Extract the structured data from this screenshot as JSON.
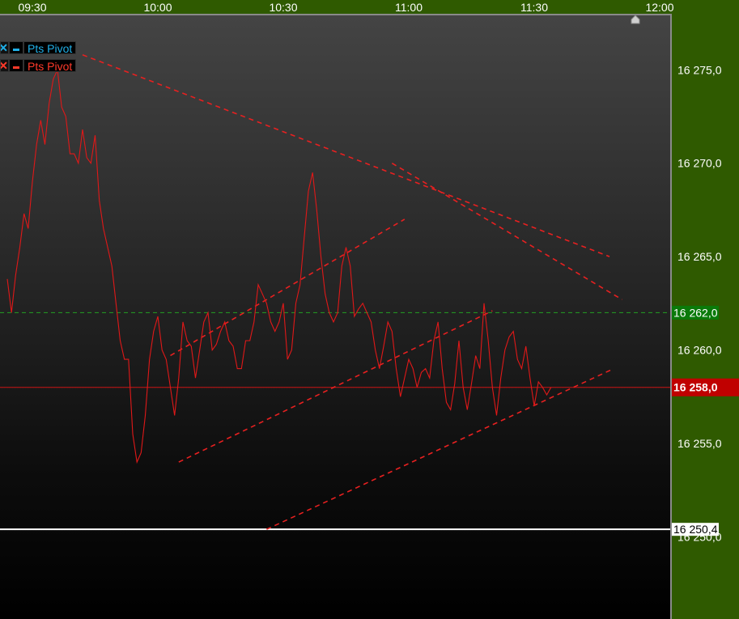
{
  "legend": [
    {
      "label": "Pts Pivot",
      "color": "#20b0e8",
      "close_glyph": "✕"
    },
    {
      "label": "Pts Pivot",
      "color": "#ff3a2a",
      "close_glyph": "✕"
    }
  ],
  "chart_data": {
    "type": "line",
    "x_axis": {
      "ticks": [
        "09:30",
        "10:00",
        "10:30",
        "11:00",
        "11:30",
        "12:00"
      ],
      "unit": "time"
    },
    "y_axis": {
      "tick_labels": [
        "16 275,0",
        "16 270,0",
        "16 265,0",
        "16 260,0",
        "16 255,0",
        "16 250,0"
      ],
      "tick_values": [
        16275.0,
        16270.0,
        16265.0,
        16260.0,
        16255.0,
        16250.0
      ],
      "ylim": [
        16245.6,
        16278.0
      ]
    },
    "series": [
      {
        "color": "#e01818",
        "times": [
          "09:24",
          "09:25",
          "09:26",
          "09:27",
          "09:28",
          "09:29",
          "09:30",
          "09:31",
          "09:32",
          "09:33",
          "09:34",
          "09:35",
          "09:36",
          "09:37",
          "09:38",
          "09:39",
          "09:40",
          "09:41",
          "09:42",
          "09:43",
          "09:44",
          "09:45",
          "09:46",
          "09:47",
          "09:48",
          "09:49",
          "09:50",
          "09:51",
          "09:52",
          "09:53",
          "09:54",
          "09:55",
          "09:56",
          "09:57",
          "09:58",
          "09:59",
          "10:00",
          "10:01",
          "10:02",
          "10:03",
          "10:04",
          "10:05",
          "10:06",
          "10:07",
          "10:08",
          "10:09",
          "10:10",
          "10:11",
          "10:12",
          "10:13",
          "10:14",
          "10:15",
          "10:16",
          "10:17",
          "10:18",
          "10:19",
          "10:20",
          "10:21",
          "10:22",
          "10:23",
          "10:24",
          "10:25",
          "10:26",
          "10:27",
          "10:28",
          "10:29",
          "10:30",
          "10:31",
          "10:32",
          "10:33",
          "10:34",
          "10:35",
          "10:36",
          "10:37",
          "10:38",
          "10:39",
          "10:40",
          "10:41",
          "10:42",
          "10:43",
          "10:44",
          "10:45",
          "10:46",
          "10:47",
          "10:48",
          "10:49",
          "10:50",
          "10:51",
          "10:52",
          "10:53",
          "10:54",
          "10:55",
          "10:56",
          "10:57",
          "10:58",
          "10:59",
          "11:00",
          "11:01",
          "11:02",
          "11:03",
          "11:04",
          "11:05",
          "11:06",
          "11:07",
          "11:08",
          "11:09",
          "11:10",
          "11:11",
          "11:12",
          "11:13",
          "11:14",
          "11:15",
          "11:16",
          "11:17",
          "11:18",
          "11:19",
          "11:20",
          "11:21",
          "11:22",
          "11:23",
          "11:24",
          "11:25",
          "11:26",
          "11:27",
          "11:28",
          "11:29",
          "11:30",
          "11:31",
          "11:32",
          "11:33",
          "11:34",
          "11:35",
          "11:36",
          "11:37",
          "11:38",
          "11:39",
          "11:40",
          "11:41",
          "11:42",
          "11:43",
          "11:44",
          "11:45",
          "11:46",
          "11:47",
          "11:48",
          "11:49",
          "11:50",
          "11:51",
          "11:52",
          "11:53"
        ],
        "values": [
          16263.8,
          16262.0,
          16264.0,
          16265.5,
          16267.3,
          16266.5,
          16269.0,
          16271.0,
          16272.3,
          16271.0,
          16273.2,
          16274.5,
          16275.0,
          16273.0,
          16272.5,
          16270.5,
          16270.5,
          16270.0,
          16271.8,
          16270.3,
          16270.0,
          16271.5,
          16268.0,
          16266.5,
          16265.5,
          16264.5,
          16262.5,
          16260.5,
          16259.5,
          16259.5,
          16255.5,
          16254.0,
          16254.5,
          16256.5,
          16259.5,
          16261.0,
          16261.8,
          16260.0,
          16259.5,
          16258.0,
          16256.5,
          16258.5,
          16261.5,
          16260.5,
          16260.2,
          16258.5,
          16260.0,
          16261.5,
          16262.0,
          16260.0,
          16260.3,
          16261.0,
          16261.5,
          16260.5,
          16260.2,
          16259.0,
          16259.0,
          16260.5,
          16260.5,
          16261.5,
          16263.5,
          16263.0,
          16262.5,
          16261.5,
          16261.0,
          16261.5,
          16262.5,
          16259.5,
          16260.0,
          16262.5,
          16263.5,
          16266.0,
          16268.5,
          16269.5,
          16267.5,
          16265.0,
          16263.0,
          16262.0,
          16261.5,
          16262.0,
          16264.5,
          16265.5,
          16264.5,
          16261.8,
          16262.2,
          16262.5,
          16262.0,
          16261.5,
          16260.0,
          16259.0,
          16260.2,
          16261.5,
          16261.0,
          16259.0,
          16257.5,
          16258.5,
          16259.5,
          16259.0,
          16258.0,
          16258.8,
          16259.0,
          16258.5,
          16260.5,
          16261.5,
          16259.0,
          16257.2,
          16256.8,
          16258.2,
          16260.5,
          16258.0,
          16256.8,
          16258.2,
          16259.7,
          16259.0,
          16262.5,
          16260.5,
          16258.0,
          16256.5,
          16258.5,
          16260.0,
          16260.7,
          16261.0,
          16259.5,
          16259.0,
          16260.2,
          16258.5,
          16257.0,
          16258.3,
          16258.0,
          16257.6,
          16258.0
        ],
        "note_values_are_prices": true
      }
    ],
    "annotations": {
      "horizontal_levels": [
        {
          "value": 16262.0,
          "label": "16 262,0",
          "color": "#22a022",
          "style": "dashed",
          "label_bg": "#0a7a0a"
        },
        {
          "value": 16258.0,
          "label": "16 258,0",
          "color": "#cc1414",
          "style": "solid",
          "label_bg": "#c00000"
        },
        {
          "value": 16250.4,
          "label": "16 250,4",
          "color": "#ffffff",
          "style": "solid",
          "label_bg": "#ffffff"
        }
      ],
      "trendlines": [
        {
          "from": [
            "09:42",
            16275.8
          ],
          "to": [
            "11:48",
            16265.0
          ]
        },
        {
          "from": [
            "10:56",
            16270.0
          ],
          "to": [
            "11:51",
            16262.7
          ]
        },
        {
          "from": [
            "10:03",
            16259.7
          ],
          "to": [
            "10:59",
            16267.0
          ]
        },
        {
          "from": [
            "10:05",
            16254.0
          ],
          "to": [
            "11:20",
            16262.1
          ]
        },
        {
          "from": [
            "10:26",
            16250.4
          ],
          "to": [
            "11:49",
            16259.0
          ]
        }
      ],
      "trendline_color": "#e82020"
    },
    "grid": false,
    "legend": "top-left"
  }
}
